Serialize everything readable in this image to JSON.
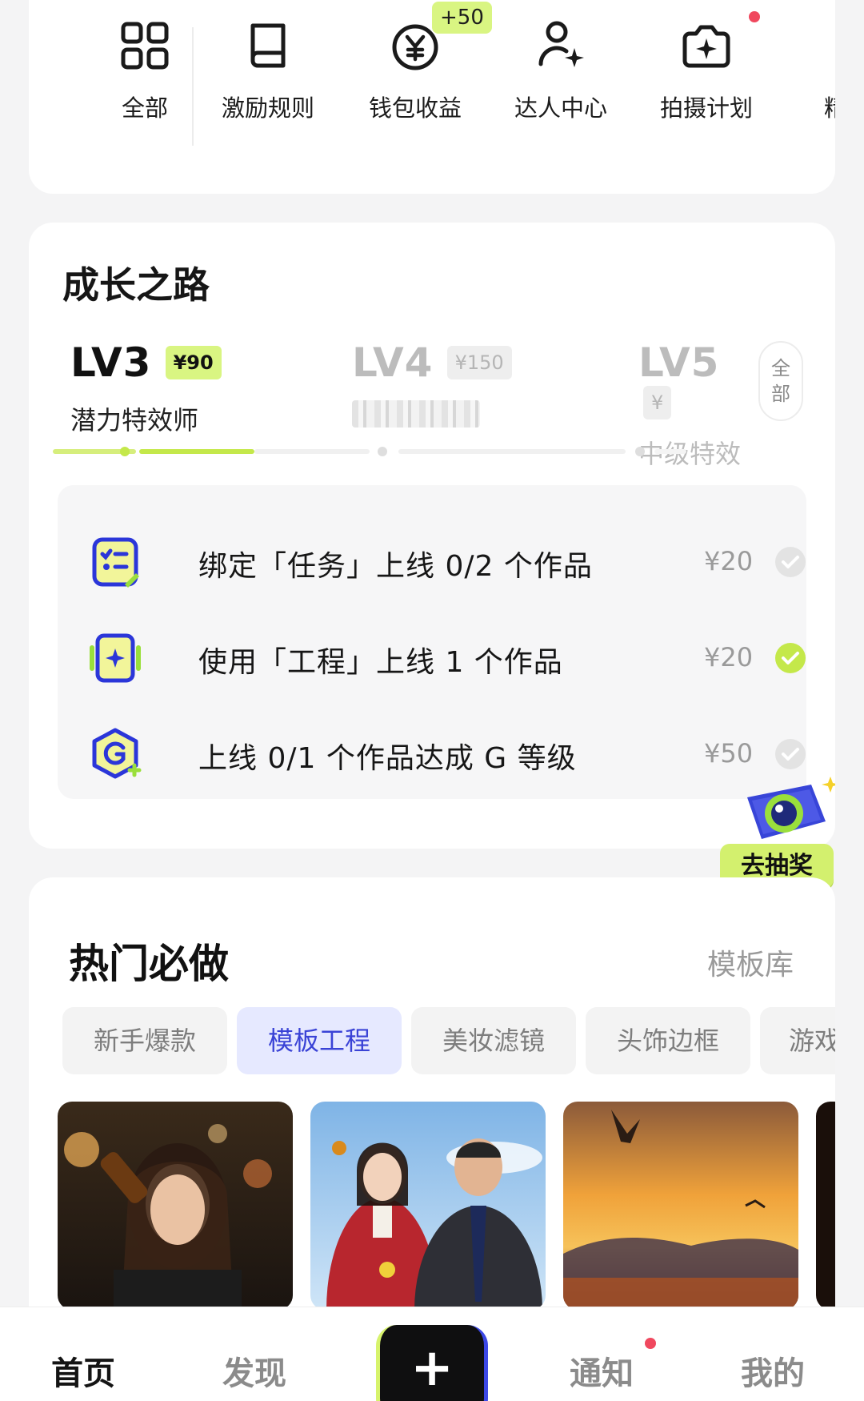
{
  "quick_links": {
    "items": [
      {
        "label": "全部",
        "icon": "grid-icon"
      },
      {
        "label": "激励规则",
        "icon": "book-icon"
      },
      {
        "label": "钱包收益",
        "icon": "yuan-coin-icon",
        "badge": "+50"
      },
      {
        "label": "达人中心",
        "icon": "user-star-icon"
      },
      {
        "label": "拍摄计划",
        "icon": "camera-sparkle-icon",
        "dot": true
      },
      {
        "label": "精选",
        "icon": "brace-icon"
      }
    ]
  },
  "growth": {
    "title": "成长之路",
    "levels": [
      {
        "name": "LV3",
        "reward": "¥90",
        "subtitle": "潜力特效师",
        "state": "current"
      },
      {
        "name": "LV4",
        "reward": "¥150",
        "subtitle": "",
        "state": "locked"
      },
      {
        "name": "LV5",
        "reward": "¥",
        "subtitle": "中级特效",
        "state": "locked"
      }
    ],
    "all_button": [
      "全",
      "部"
    ],
    "progress_fraction": 0.27,
    "tasks": [
      {
        "icon": "task-list-icon",
        "text": "绑定「任务」上线 0/2 个作品",
        "reward": "¥20",
        "done": false
      },
      {
        "icon": "project-plus-icon",
        "text": "使用「工程」上线 1 个作品",
        "reward": "¥20",
        "done": true
      },
      {
        "icon": "grade-g-icon",
        "text": "上线 0/1 个作品达成 G 等级",
        "reward": "¥50",
        "done": false
      }
    ]
  },
  "lottery": {
    "label": "去抽奖",
    "icon": "camera-gift-icon"
  },
  "hot": {
    "title": "热门必做",
    "more_label": "模板库",
    "tabs": [
      "新手爆款",
      "模板工程",
      "美妆滤镜",
      "头饰边框",
      "游戏"
    ],
    "active_tab": 1,
    "thumbnails": [
      "night-street-drinking-photo",
      "couple-portrait-photo",
      "sunset-seagull-photo"
    ]
  },
  "bottom_nav": {
    "items": [
      {
        "label": "首页",
        "active": true
      },
      {
        "label": "发现",
        "active": false
      },
      {
        "label": "+",
        "type": "create"
      },
      {
        "label": "通知",
        "active": false,
        "dot": true
      },
      {
        "label": "我的",
        "active": false
      }
    ]
  },
  "colors": {
    "accent_lime": "#d9f582",
    "accent_blue": "#3a43d6",
    "notification_red": "#f0485e",
    "check_green": "#c4e84a"
  }
}
